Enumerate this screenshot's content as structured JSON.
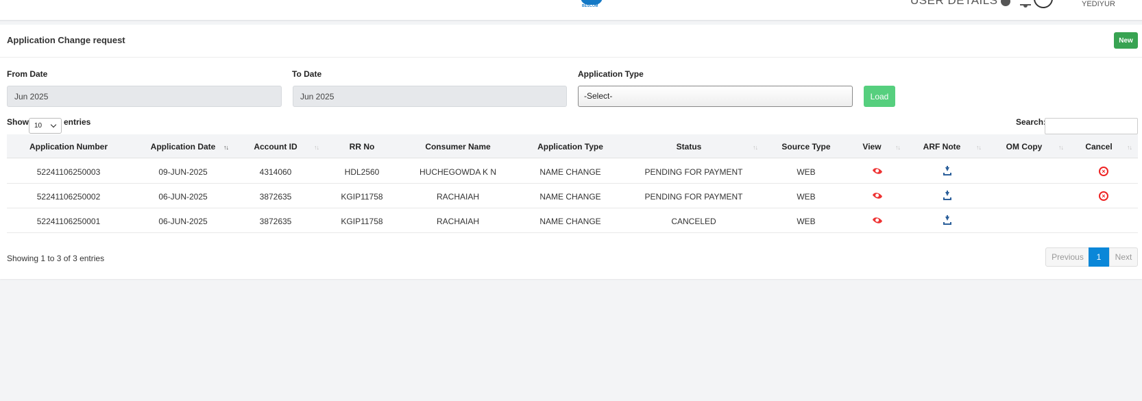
{
  "header": {
    "logo_text": "BESCOM",
    "user_details_label": "USER DETAILS",
    "user_name": "YEDIYUR"
  },
  "page": {
    "title": "Application Change request",
    "new_button": "New"
  },
  "filters": {
    "from_date_label": "From Date",
    "from_date_value": "Jun 2025",
    "to_date_label": "To Date",
    "to_date_value": "Jun 2025",
    "app_type_label": "Application Type",
    "app_type_value": "-Select-",
    "load_button": "Load"
  },
  "table_controls": {
    "show_label": "Show",
    "entries_value": "10",
    "entries_label": "entries",
    "search_label": "Search:"
  },
  "columns": [
    "Application Number",
    "Application Date",
    "Account ID",
    "RR No",
    "Consumer Name",
    "Application Type",
    "Status",
    "Source Type",
    "View",
    "ARF Note",
    "OM Copy",
    "Cancel"
  ],
  "rows": [
    {
      "app_no": "52241106250003",
      "app_date": "09-JUN-2025",
      "account_id": "4314060",
      "rr_no": "HDL2560",
      "consumer": "HUCHEGOWDA K N",
      "app_type": "NAME CHANGE",
      "status": "PENDING FOR PAYMENT",
      "source": "WEB",
      "cancel": true
    },
    {
      "app_no": "52241106250002",
      "app_date": "06-JUN-2025",
      "account_id": "3872635",
      "rr_no": "KGIP11758",
      "consumer": "RACHAIAH",
      "app_type": "NAME CHANGE",
      "status": "PENDING FOR PAYMENT",
      "source": "WEB",
      "cancel": true
    },
    {
      "app_no": "52241106250001",
      "app_date": "06-JUN-2025",
      "account_id": "3872635",
      "rr_no": "KGIP11758",
      "consumer": "RACHAIAH",
      "app_type": "NAME CHANGE",
      "status": "CANCELED",
      "source": "WEB",
      "cancel": false
    }
  ],
  "footer": {
    "info": "Showing 1 to 3 of 3 entries",
    "previous": "Previous",
    "page": "1",
    "next": "Next"
  },
  "colors": {
    "new_button": "#38a352",
    "load_button": "#56cf7e",
    "view_icon": "#e33333",
    "download_icon": "#2b5f9a",
    "cancel_icon": "#e22222",
    "active_page": "#0b87d8"
  },
  "icons": {
    "view": "eye-icon",
    "arf_note": "download-icon",
    "cancel": "cancel-circle-icon"
  }
}
